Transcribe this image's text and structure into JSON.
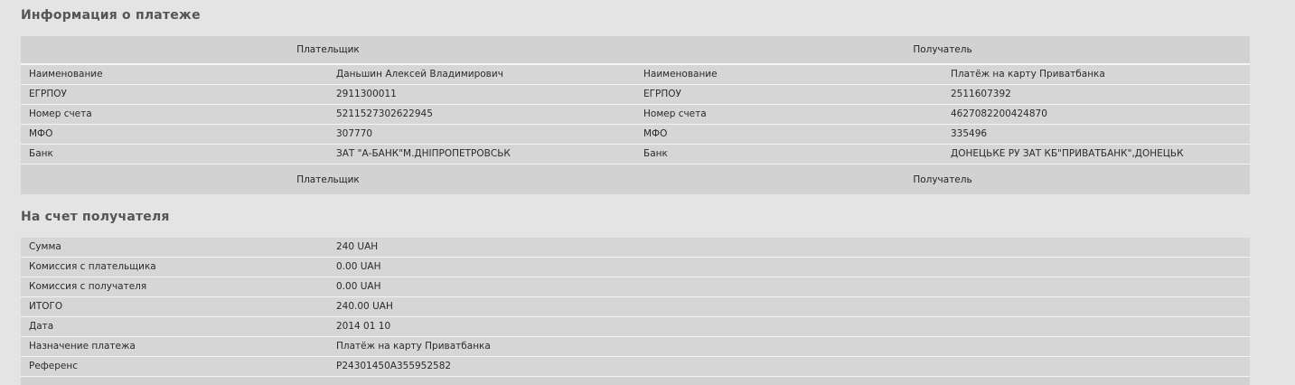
{
  "sections": {
    "payment_info_title": "Информация о платеже",
    "recipient_account_title": "На счет получателя"
  },
  "payment_table": {
    "header": {
      "payer": "Плательщик",
      "recipient": "Получатель"
    },
    "rows": [
      {
        "label_left": "Наименование",
        "payer": "Даньшин Алексей Владимирович",
        "label_right": "Наименование",
        "recipient": "Платёж на карту Приватбанка"
      },
      {
        "label_left": "ЕГРПОУ",
        "payer": "2911300011",
        "label_right": "ЕГРПОУ",
        "recipient": "2511607392"
      },
      {
        "label_left": "Номер счета",
        "payer": "5211527302622945",
        "label_right": "Номер счета",
        "recipient": "4627082200424870"
      },
      {
        "label_left": "МФО",
        "payer": "307770",
        "label_right": "МФО",
        "recipient": "335496"
      },
      {
        "label_left": "Банк",
        "payer": "ЗАТ \"А-БАНК\"М.ДНІПРОПЕТРОВСЬК",
        "label_right": "Банк",
        "recipient": "ДОНЕЦЬКЕ РУ ЗАТ КБ\"ПРИВАТБАНК\",ДОНЕЦЬК"
      }
    ],
    "footer": {
      "payer": "Плательщик",
      "recipient": "Получатель"
    }
  },
  "account_table": {
    "rows": [
      {
        "label": "Сумма",
        "value": "240  UAH"
      },
      {
        "label": "Комиссия с плательщика",
        "value": "0.00  UAH"
      },
      {
        "label": "Комиссия с получателя",
        "value": "0.00  UAH"
      },
      {
        "label": "ИТОГО",
        "value": "240.00  UAH"
      },
      {
        "label": "Дата",
        "value": "2014 01 10"
      },
      {
        "label": "Назначение платежа",
        "value": "Платёж на карту Приватбанка"
      },
      {
        "label": "Референс",
        "value": "P24301450A355952582"
      }
    ]
  }
}
